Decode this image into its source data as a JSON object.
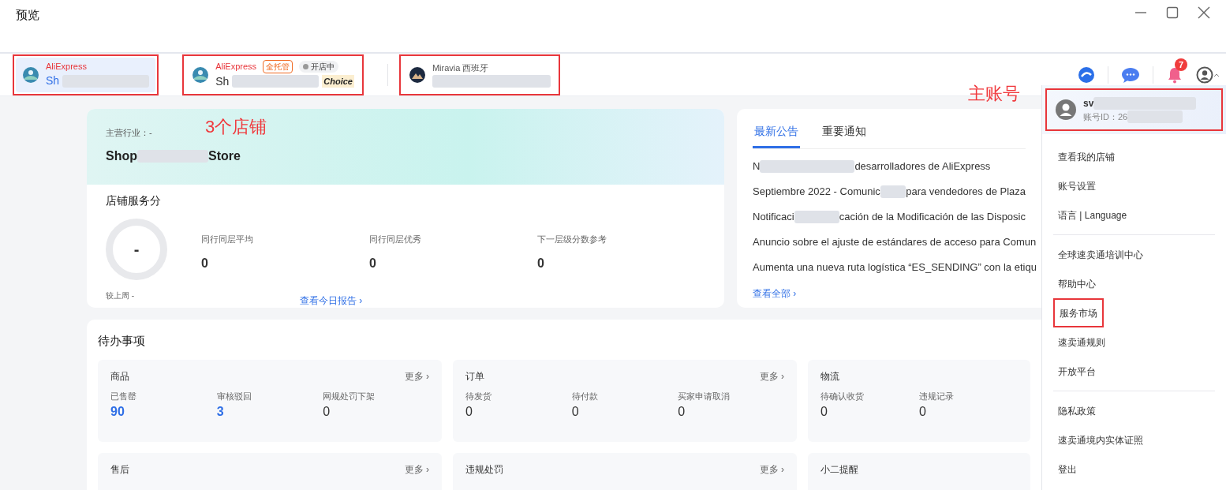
{
  "window": {
    "title": "预览"
  },
  "stores": [
    {
      "platform": "AliExpress",
      "name": "Sh",
      "selected": true,
      "kind": "aliexpress"
    },
    {
      "platform": "AliExpress",
      "name": "Sh",
      "selected": false,
      "tag": "全托管",
      "status": "开店中",
      "logo_text": "Choice",
      "kind": "aliexpress"
    },
    {
      "platform": "Miravia 西班牙",
      "selected": false,
      "kind": "miravia"
    }
  ],
  "toolbar": {
    "notification_count": "7"
  },
  "store_card": {
    "industry": "主营行业：-",
    "store_name_start": "Shop",
    "store_name_end": "Store",
    "annotation": "3个店铺",
    "score_title": "店铺服务分",
    "score": "-",
    "compare": "较上周 -",
    "stats": [
      {
        "label": "同行同层平均",
        "value": "0"
      },
      {
        "label": "同行同层优秀",
        "value": "0"
      },
      {
        "label": "下一层级分数参考",
        "value": "0"
      }
    ],
    "report_link": "查看今日报告 ›"
  },
  "notices": {
    "tabs": [
      {
        "label": "最新公告",
        "selected": true
      },
      {
        "label": "重要通知",
        "selected": false
      }
    ],
    "items": [
      {
        "start": "N",
        "end": "desarrolladores de AliExpress"
      },
      {
        "start": "Septiembre 2022 - Comunic",
        "end": "para vendedores de Plaza"
      },
      {
        "start": "Notificaci",
        "end": "cación de la Modificación de las Disposic"
      },
      {
        "start": "Anuncio sobre el ajuste de estándares de acceso para Comun"
      },
      {
        "start": "Aumenta una nueva ruta logística “ES_SENDING” con la etiqu"
      }
    ],
    "view_all": "查看全部 ›"
  },
  "todo": {
    "title": "待办事项",
    "groups": [
      {
        "title": "商品",
        "more": "更多 ›",
        "items": [
          {
            "label": "已售罄",
            "value": "90",
            "link": true
          },
          {
            "label": "审核驳回",
            "value": "3",
            "link": true
          },
          {
            "label": "网规处罚下架",
            "value": "0",
            "link": false
          }
        ]
      },
      {
        "title": "订单",
        "more": "更多 ›",
        "items": [
          {
            "label": "待发货",
            "value": "0",
            "link": false
          },
          {
            "label": "待付款",
            "value": "0",
            "link": false
          },
          {
            "label": "买家申请取消",
            "value": "0",
            "link": false
          }
        ]
      },
      {
        "title": "物流",
        "items": [
          {
            "label": "待确认收货",
            "value": "0",
            "link": false
          },
          {
            "label": "违规记录",
            "value": "0",
            "link": false
          }
        ]
      },
      {
        "title": "售后",
        "more": "更多 ›"
      },
      {
        "title": "违规处罚",
        "more": "更多 ›"
      },
      {
        "title": "小二提醒"
      }
    ]
  },
  "account_menu": {
    "annotation": "主账号",
    "user": "sv",
    "account_id": "账号ID：26",
    "sections": [
      [
        {
          "label": "查看我的店铺",
          "highlighted": false
        },
        {
          "label": "账号设置",
          "highlighted": false
        },
        {
          "label": "语言 | Language",
          "highlighted": false
        }
      ],
      [
        {
          "label": "全球速卖通培训中心",
          "highlighted": false
        },
        {
          "label": "帮助中心",
          "highlighted": false
        },
        {
          "label": "服务市场",
          "highlighted": true
        },
        {
          "label": "速卖通规则",
          "highlighted": false
        },
        {
          "label": "开放平台",
          "highlighted": false
        }
      ],
      [
        {
          "label": "隐私政策",
          "highlighted": false
        },
        {
          "label": "速卖通境内实体证照",
          "highlighted": false
        },
        {
          "label": "登出",
          "highlighted": false
        }
      ]
    ]
  }
}
